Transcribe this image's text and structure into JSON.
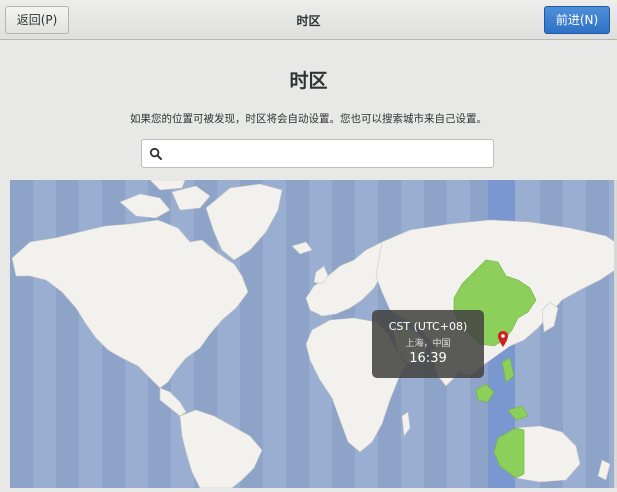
{
  "header": {
    "title": "时区",
    "back_label": "返回(P)",
    "next_label": "前进(N)"
  },
  "page": {
    "title": "时区",
    "description": "如果您的位置可被发现，时区将会自动设置。您也可以搜索城市来自己设置。"
  },
  "search": {
    "value": "",
    "placeholder": "",
    "icon": "search-icon"
  },
  "map": {
    "selected": {
      "timezone": "CST (UTC+08)",
      "location": "上海，中国",
      "time": "16:39"
    },
    "colors": {
      "ocean": "#9aaed1",
      "ocean_band_alt": "#8ea3c8",
      "selected_band": "#7a97cf",
      "land": "#f2f1ee",
      "highlight_land": "#8ccf5a",
      "pin": "#cc2222"
    }
  },
  "colors": {
    "accent": "#3478c8",
    "background": "#e8e8e7"
  }
}
